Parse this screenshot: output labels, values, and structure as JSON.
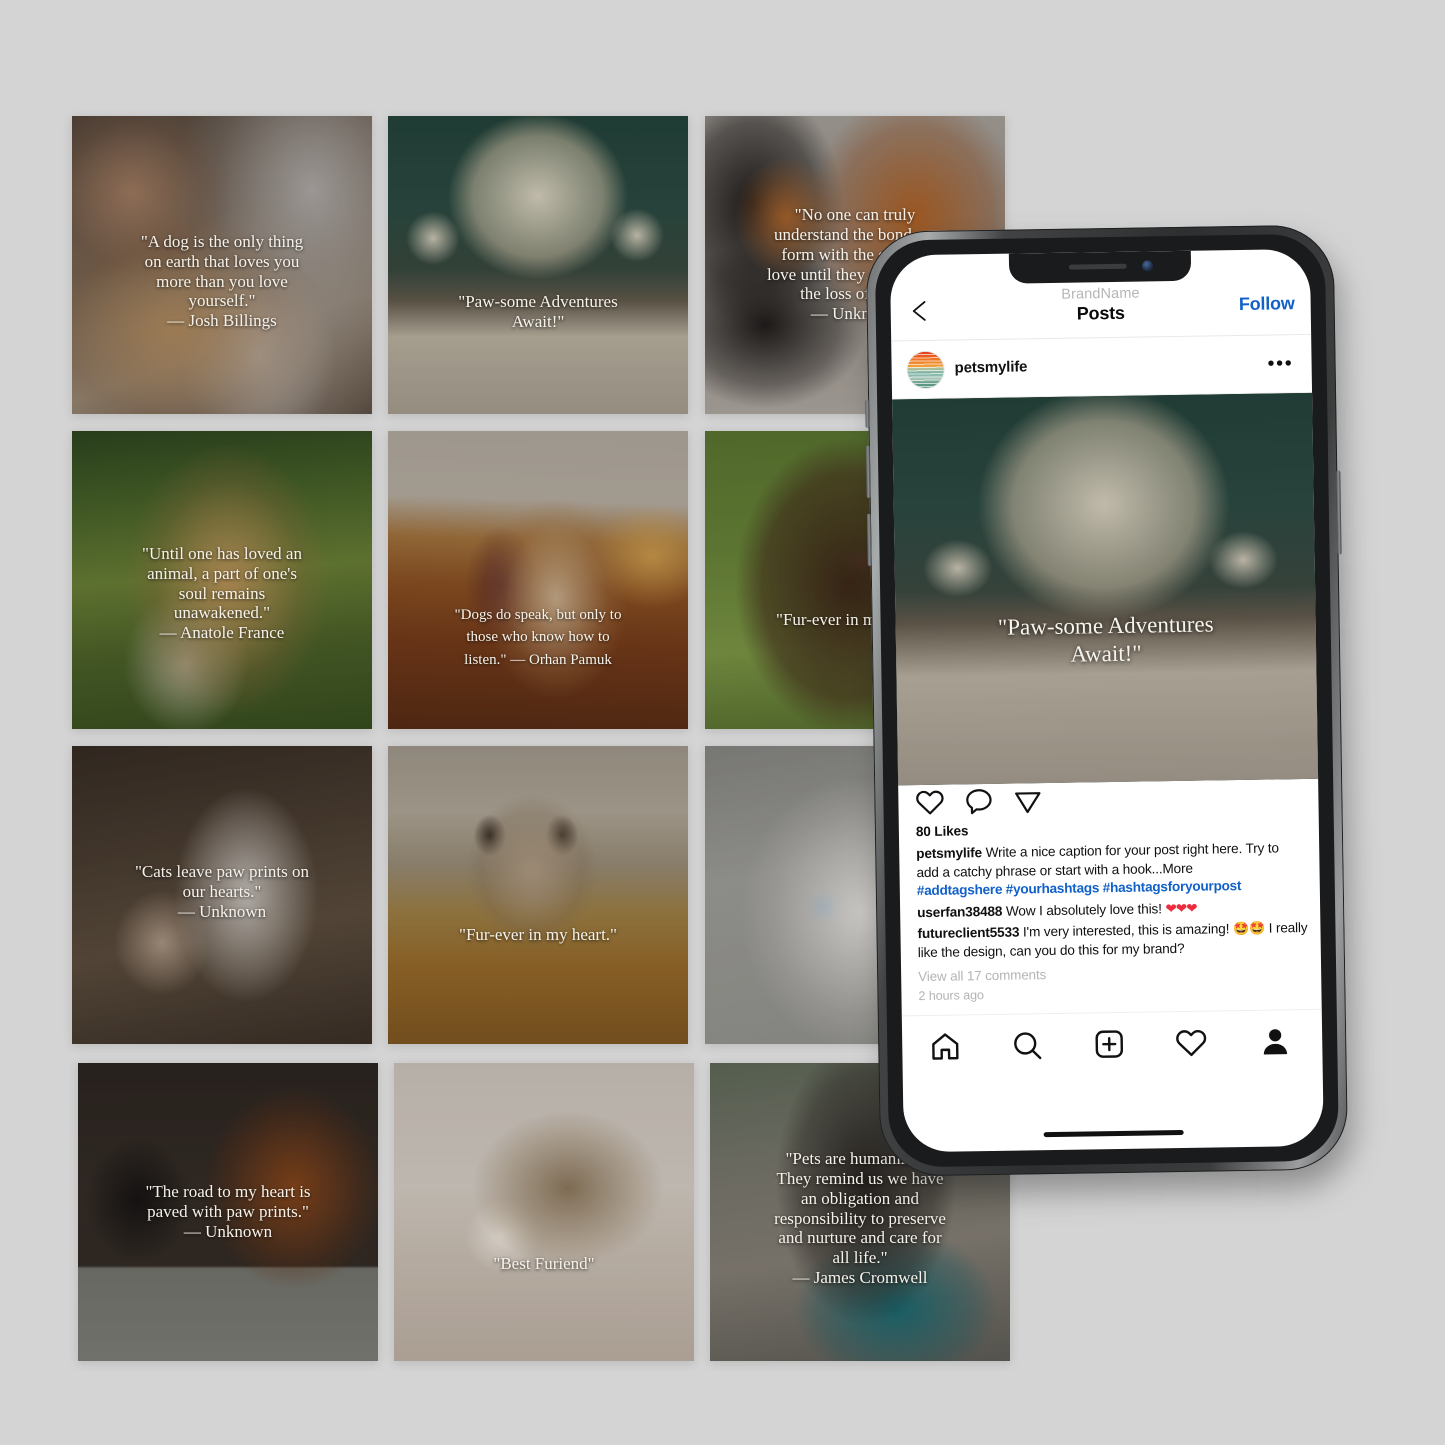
{
  "background_color": "#d4d4d4",
  "grid": {
    "tiles": [
      {
        "id": "tile-1",
        "row": 1,
        "col": 1,
        "quote": "\"A dog is the only thing\non earth that loves you\nmore than you love\nyourself.\"\n— Josh Billings",
        "subject": "girl-hugging-beagle-puppy"
      },
      {
        "id": "tile-2",
        "row": 1,
        "col": 2,
        "quote": "\"Paw-some Adventures\nAwait!\"",
        "subject": "yellow-labrador-on-gate"
      },
      {
        "id": "tile-3",
        "row": 1,
        "col": 3,
        "quote": "\"No one can truly\nunderstand the bond we\nform with the cats we\nlove until they experience\nthe loss of one.\"\n— Unknown",
        "subject": "black-dog-and-ginger-cat"
      },
      {
        "id": "tile-4",
        "row": 2,
        "col": 1,
        "quote": "\"Until one has loved an\nanimal, a part of one's\nsoul remains\nunawakened.\"\n— Anatole France",
        "subject": "dog-carrying-stick"
      },
      {
        "id": "tile-5",
        "row": 2,
        "col": 2,
        "quote": "\"Dogs do speak, but only to\nthose who know how to\nlisten.\" — Orhan Pamuk",
        "subject": "girl-and-dog-at-sunset"
      },
      {
        "id": "tile-6",
        "row": 2,
        "col": 3,
        "quote": "\"Fur-ever in my heart.\"",
        "subject": "chocolate-labrador-puppy"
      },
      {
        "id": "tile-7",
        "row": 3,
        "col": 1,
        "quote": "\"Cats leave paw prints on\nour hearts.\"\n— Unknown",
        "subject": "white-kitten-in-arms"
      },
      {
        "id": "tile-8",
        "row": 3,
        "col": 2,
        "quote": "\"Fur-ever in my heart.\"",
        "subject": "siamese-cat-on-basket"
      },
      {
        "id": "tile-9",
        "row": 3,
        "col": 3,
        "quote": "",
        "subject": "blue-eyed-fluffy-kitten"
      },
      {
        "id": "tile-10",
        "row": 4,
        "col": 1,
        "quote": "\"The road to my heart is\npaved with paw prints.\"\n— Unknown",
        "subject": "black-cat-and-spaniel"
      },
      {
        "id": "tile-11",
        "row": 4,
        "col": 2,
        "quote": "\"Best Furiend\"",
        "subject": "hedgehog"
      },
      {
        "id": "tile-12",
        "row": 4,
        "col": 3,
        "quote": "\"Pets are humanizing.\nThey remind us we have\nan obligation and\nresponsibility to preserve\nand nurture and care for\nall life.\"\n— James Cromwell",
        "subject": "dog-with-teal-bandana"
      }
    ]
  },
  "phone": {
    "app": {
      "header": {
        "back_icon": "chevron-left-icon",
        "brand": "BrandName",
        "title": "Posts",
        "follow_label": "Follow",
        "follow_color": "#1161c9"
      },
      "post_header": {
        "avatar_icon": "sunset-gradient-avatar",
        "username": "petsmylife",
        "more_icon": "ellipsis-icon"
      },
      "post_image": {
        "subject": "yellow-labrador-on-gate",
        "overlay_text": "\"Paw-some Adventures\nAwait!\""
      },
      "actions": {
        "like_icon": "heart-icon",
        "comment_icon": "speech-bubble-icon",
        "share_icon": "paper-plane-icon"
      },
      "likes": "80 Likes",
      "caption": {
        "author": "petsmylife",
        "text": "Write a nice caption for your post right here. Try to add a catchy phrase or start with a hook...More"
      },
      "hashtags": "#addtagshere #yourhashtags #hashtagsforyourpost",
      "comments": [
        {
          "author": "userfan38488",
          "text": "Wow I absolutely love this!",
          "emoji": "❤❤❤"
        },
        {
          "author": "futureclient5533",
          "text": "I'm very interested, this is amazing!",
          "emoji": "🤩🤩",
          "text2": "I really like the design, can you do this for my brand?"
        }
      ],
      "view_all": "View all 17 comments",
      "timestamp": "2 hours ago",
      "nav": [
        {
          "icon": "home-icon",
          "label": "Home"
        },
        {
          "icon": "search-icon",
          "label": "Search"
        },
        {
          "icon": "plus-box-icon",
          "label": "Create"
        },
        {
          "icon": "heart-icon",
          "label": "Activity"
        },
        {
          "icon": "person-icon",
          "label": "Profile"
        }
      ]
    }
  }
}
